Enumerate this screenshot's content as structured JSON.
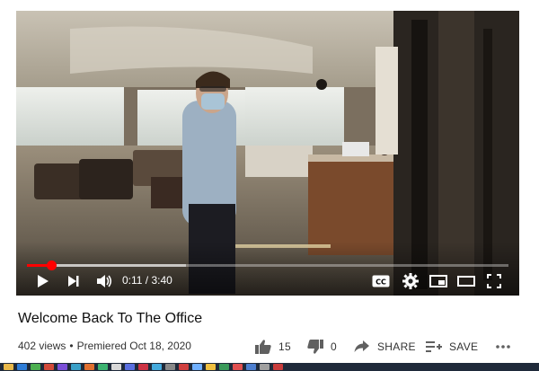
{
  "video": {
    "title": "Welcome Back To The Office",
    "views": "402 views",
    "separator": "•",
    "premiered": "Premiered Oct 18, 2020",
    "time_current": "0:11",
    "time_total": "3:40",
    "time_display": "0:11 / 3:40",
    "progress_fraction": 0.05,
    "buffered_fraction": 0.33
  },
  "actions": {
    "like_count": "15",
    "dislike_count": "0",
    "share_label": "SHARE",
    "save_label": "SAVE",
    "more_label": "..."
  },
  "icons": {
    "play": "play-icon",
    "next": "next-icon",
    "volume": "volume-icon",
    "captions": "captions-icon",
    "settings": "gear-icon",
    "miniplayer": "miniplayer-icon",
    "theater": "theater-icon",
    "fullscreen": "fullscreen-icon",
    "like": "thumbs-up-icon",
    "dislike": "thumbs-down-icon",
    "share": "share-icon",
    "save": "playlist-add-icon",
    "more": "more-icon"
  },
  "colors": {
    "progress": "#ff0000",
    "text": "#0f0f0f",
    "meta_text": "#606060",
    "taskbar": "#1f2a3a"
  },
  "taskbar_icons": [
    "#e8b84a",
    "#2e7dd8",
    "#4caf50",
    "#d24a3a",
    "#7a4fd8",
    "#3aa0c8",
    "#e07030",
    "#3cb371",
    "#d8d8d8",
    "#5a6fe0",
    "#cc3344",
    "#44aadd",
    "#888888",
    "#d04040",
    "#70b0ff",
    "#f0c040",
    "#3a9a5a",
    "#e05050",
    "#4d7fd0",
    "#a0a0a0",
    "#c83c3c"
  ]
}
